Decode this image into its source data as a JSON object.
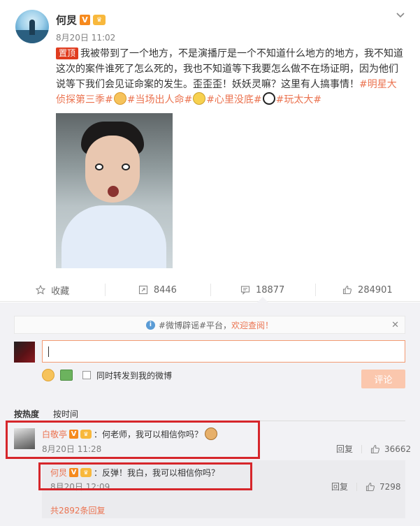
{
  "post": {
    "author": "何炅",
    "time": "8月20日 11:02",
    "badge_v": "V",
    "pinned_label": "置顶",
    "text_1": "我被带到了一个地方，不是演播厅是一个不知道什么地方的地方，我不知道这次的案件谁死了怎么死的，我也不知道等下我要怎么做不在场证明，因为他们说等下我们会见证命案的发生。歪歪歪！妖妖灵嘛？这里有人搞事情！",
    "tag_1": "#明星大侦探第三季#",
    "tag_2": "#当场出人命#",
    "tag_3": "#心里没底#",
    "tag_4": "#玩太大#"
  },
  "actions": {
    "favorite": "收藏",
    "repost": "8446",
    "comments": "18877",
    "likes": "284901"
  },
  "notice": {
    "text": "#微博辟谣#平台，",
    "link": "欢迎查阅！"
  },
  "composer": {
    "repost_option": "同时转发到我的微博",
    "submit": "评论"
  },
  "sort": {
    "hot": "按热度",
    "time": "按时间"
  },
  "comment": {
    "author": "白敬亭",
    "text": "：何老师，我可以相信你吗？",
    "time": "8月20日 11:28",
    "reply": "回复",
    "likes": "36662"
  },
  "reply": {
    "author": "何炅",
    "text": "：反弹！我白，我可以相信你吗？",
    "time": "8月20日 12:09",
    "reply": "回复",
    "likes": "7298"
  },
  "more_replies": "共2892条回复",
  "colors": {
    "accent": "#eb7350",
    "highlight_box": "#d6262b",
    "pinned": "#e03c1f"
  }
}
